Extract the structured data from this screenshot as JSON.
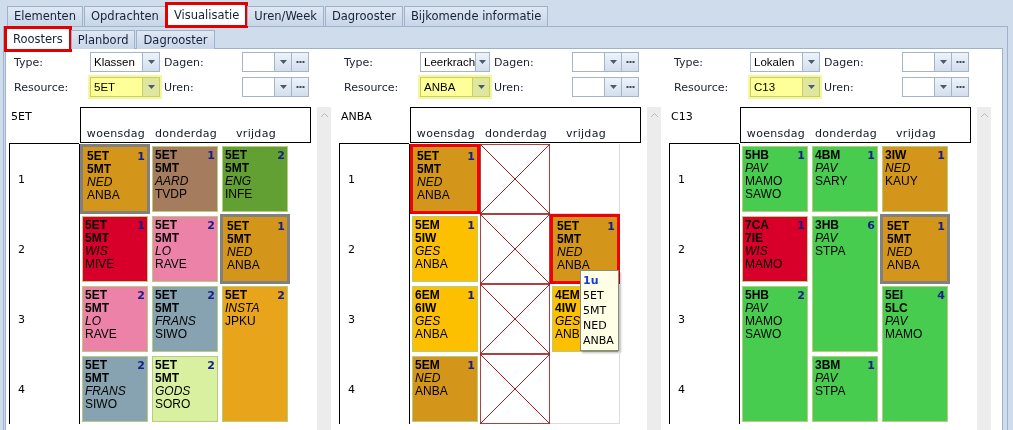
{
  "tabs": [
    {
      "label": "Elementen",
      "selected": false,
      "highlighted": false
    },
    {
      "label": "Opdrachten",
      "selected": false,
      "highlighted": false
    },
    {
      "label": "Visualisatie",
      "selected": true,
      "highlighted": true
    },
    {
      "label": "Uren/Week",
      "selected": false,
      "highlighted": false
    },
    {
      "label": "Dagrooster",
      "selected": false,
      "highlighted": false
    },
    {
      "label": "Bijkomende informatie",
      "selected": false,
      "highlighted": false
    }
  ],
  "subtabs": [
    {
      "label": "Roosters",
      "selected": true,
      "highlighted": true
    },
    {
      "label": "Planbord",
      "selected": false,
      "highlighted": false
    },
    {
      "label": "Dagrooster",
      "selected": false,
      "highlighted": false
    }
  ],
  "panels": [
    {
      "type_label": "Type:",
      "type_value": "Klassen",
      "days_label": "Dagen:",
      "resource_label": "Resource:",
      "resource_value": "5ET",
      "hours_label": "Uren:",
      "title": "5ET",
      "days": [
        "woensdag",
        "donderdag",
        "vrijdag"
      ],
      "rows": [
        {
          "period": "1",
          "cells": [
            {
              "kind": "lesson",
              "classes": [
                "5ET",
                "5MT"
              ],
              "subject": "NED",
              "teachers": [
                "ANBA"
              ],
              "count": "1",
              "color": "#d4961a",
              "selected": true,
              "conflict": false
            },
            {
              "kind": "lesson",
              "classes": [
                "5ET",
                "5MT"
              ],
              "subject": "AARD",
              "teachers": [
                "TVDP"
              ],
              "count": "1",
              "color": "#a67c5e",
              "selected": false,
              "conflict": false
            },
            {
              "kind": "lesson",
              "classes": [
                "5ET",
                "5MT"
              ],
              "subject": "ENG",
              "teachers": [
                "INFE"
              ],
              "count": "2",
              "color": "#62a033",
              "selected": false,
              "conflict": false
            }
          ]
        },
        {
          "period": "2",
          "cells": [
            {
              "kind": "lesson",
              "classes": [
                "5ET",
                "5MT"
              ],
              "subject": "WIS",
              "teachers": [
                "MIVE"
              ],
              "count": "1",
              "color": "#d8002a",
              "selected": false,
              "conflict": false
            },
            {
              "kind": "lesson",
              "classes": [
                "5ET",
                "5MT"
              ],
              "subject": "LO",
              "teachers": [
                "RAVE"
              ],
              "count": "2",
              "color": "#ec82a8",
              "selected": false,
              "conflict": false
            },
            {
              "kind": "lesson",
              "classes": [
                "5ET",
                "5MT"
              ],
              "subject": "NED",
              "teachers": [
                "ANBA"
              ],
              "count": "1",
              "color": "#d4961a",
              "selected": true,
              "conflict": false
            }
          ]
        },
        {
          "period": "3",
          "cells": [
            {
              "kind": "lesson",
              "classes": [
                "5ET",
                "5MT"
              ],
              "subject": "LO",
              "teachers": [
                "RAVE"
              ],
              "count": "2",
              "color": "#ec82a8",
              "selected": false,
              "conflict": false
            },
            {
              "kind": "lesson",
              "classes": [
                "5ET",
                "5MT"
              ],
              "subject": "FRANS",
              "teachers": [
                "SIWO"
              ],
              "count": "2",
              "color": "#87a2b0",
              "selected": false,
              "conflict": false
            },
            {
              "kind": "lesson",
              "classes": [
                "5ET"
              ],
              "subject": "INSTA",
              "teachers": [
                "JPKU"
              ],
              "count": "2",
              "color": "#e8a41a",
              "selected": false,
              "conflict": false
            }
          ]
        },
        {
          "period": "4",
          "cells": [
            {
              "kind": "lesson",
              "classes": [
                "5ET",
                "5MT"
              ],
              "subject": "FRANS",
              "teachers": [
                "SIWO"
              ],
              "count": "2",
              "color": "#87a2b0",
              "selected": false,
              "conflict": false
            },
            {
              "kind": "lesson",
              "classes": [
                "5ET",
                "5MT"
              ],
              "subject": "GODS",
              "teachers": [
                "SORO"
              ],
              "count": "2",
              "color": "#d8f0a0",
              "selected": false,
              "conflict": false
            },
            {
              "kind": "continued"
            }
          ]
        }
      ]
    },
    {
      "type_label": "Type:",
      "type_value": "Leerkrach",
      "days_label": "Dagen:",
      "resource_label": "Resource:",
      "resource_value": "ANBA",
      "hours_label": "Uren:",
      "title": "ANBA",
      "days": [
        "woensdag",
        "donderdag",
        "vrijdag"
      ],
      "rows": [
        {
          "period": "1",
          "cells": [
            {
              "kind": "lesson",
              "classes": [
                "5ET",
                "5MT"
              ],
              "subject": "NED",
              "teachers": [
                "ANBA"
              ],
              "count": "1",
              "color": "#d4961a",
              "selected": false,
              "conflict": true
            },
            {
              "kind": "blocked"
            },
            {
              "kind": "empty"
            }
          ]
        },
        {
          "period": "2",
          "cells": [
            {
              "kind": "lesson",
              "classes": [
                "5EM",
                "5IW"
              ],
              "subject": "GES",
              "teachers": [
                "ANBA"
              ],
              "count": "1",
              "color": "#fcc000",
              "selected": false,
              "conflict": false
            },
            {
              "kind": "blocked"
            },
            {
              "kind": "lesson",
              "classes": [
                "5ET",
                "5MT"
              ],
              "subject": "NED",
              "teachers": [
                "ANBA"
              ],
              "count": "1",
              "color": "#d4961a",
              "selected": false,
              "conflict": true,
              "tooltip": {
                "title": "1u",
                "lines": [
                  "5ET",
                  "5MT",
                  "NED",
                  "ANBA"
                ]
              }
            }
          ]
        },
        {
          "period": "3",
          "cells": [
            {
              "kind": "lesson",
              "classes": [
                "6EM",
                "6IW"
              ],
              "subject": "GES",
              "teachers": [
                "ANBA"
              ],
              "count": "1",
              "color": "#fcc000",
              "selected": false,
              "conflict": false
            },
            {
              "kind": "blocked"
            },
            {
              "kind": "lesson",
              "classes": [
                "4EM",
                "4IW"
              ],
              "subject": "GES",
              "teachers": [
                "ANB"
              ],
              "color": "#fcc000",
              "selected": false,
              "conflict": false
            }
          ]
        },
        {
          "period": "4",
          "cells": [
            {
              "kind": "lesson",
              "classes": [
                "5EM"
              ],
              "subject": "NED",
              "teachers": [
                "ANBA"
              ],
              "count": "1",
              "color": "#d4961a",
              "selected": false,
              "conflict": false
            },
            {
              "kind": "blocked"
            },
            {
              "kind": "empty"
            }
          ]
        }
      ]
    },
    {
      "type_label": "Type:",
      "type_value": "Lokalen",
      "days_label": "Dagen:",
      "resource_label": "Resource:",
      "resource_value": "C13",
      "hours_label": "Uren:",
      "title": "C13",
      "days": [
        "woensdag",
        "donderdag",
        "vrijdag"
      ],
      "rows": [
        {
          "period": "1",
          "cells": [
            {
              "kind": "lesson",
              "classes": [
                "5HB"
              ],
              "subject": "PAV",
              "teachers": [
                "MAMO",
                "SAWO"
              ],
              "count": "1",
              "color": "#48cc50",
              "selected": false,
              "conflict": false
            },
            {
              "kind": "lesson",
              "classes": [
                "4BM"
              ],
              "subject": "PAV",
              "teachers": [
                "SARY"
              ],
              "count": "1",
              "color": "#48cc50",
              "selected": false,
              "conflict": false
            },
            {
              "kind": "lesson",
              "classes": [
                "3IW"
              ],
              "subject": "NED",
              "teachers": [
                "KAUY"
              ],
              "count": "1",
              "color": "#d4961a",
              "selected": false,
              "conflict": false
            }
          ]
        },
        {
          "period": "2",
          "cells": [
            {
              "kind": "lesson",
              "classes": [
                "7CA",
                "7IE"
              ],
              "subject": "WIS",
              "teachers": [
                "MAMO"
              ],
              "count": "1",
              "color": "#d8002a",
              "selected": false,
              "conflict": false
            },
            {
              "kind": "lesson",
              "classes": [
                "3HB"
              ],
              "subject": "PAV",
              "teachers": [
                "STPA"
              ],
              "count": "6",
              "color": "#48cc50",
              "selected": false,
              "conflict": false
            },
            {
              "kind": "lesson",
              "classes": [
                "5ET",
                "5MT"
              ],
              "subject": "NED",
              "teachers": [
                "ANBA"
              ],
              "count": "1",
              "color": "#d4961a",
              "selected": true,
              "conflict": false
            }
          ]
        },
        {
          "period": "3",
          "cells": [
            {
              "kind": "lesson",
              "classes": [
                "5HB"
              ],
              "subject": "PAV",
              "teachers": [
                "MAMO",
                "SAWO"
              ],
              "count": "2",
              "color": "#48cc50",
              "selected": false,
              "conflict": false
            },
            {
              "kind": "continued"
            },
            {
              "kind": "lesson",
              "classes": [
                "5EI",
                "5LC"
              ],
              "subject": "PAV",
              "teachers": [
                "MAMO"
              ],
              "count": "4",
              "color": "#48cc50",
              "selected": false,
              "conflict": false
            }
          ]
        },
        {
          "period": "4",
          "cells": [
            {
              "kind": "continued"
            },
            {
              "kind": "lesson",
              "classes": [
                "3BM"
              ],
              "subject": "PAV",
              "teachers": [
                "STPA"
              ],
              "count": "1",
              "color": "#48cc50",
              "selected": false,
              "conflict": false
            },
            {
              "kind": "continued"
            }
          ]
        }
      ]
    }
  ]
}
